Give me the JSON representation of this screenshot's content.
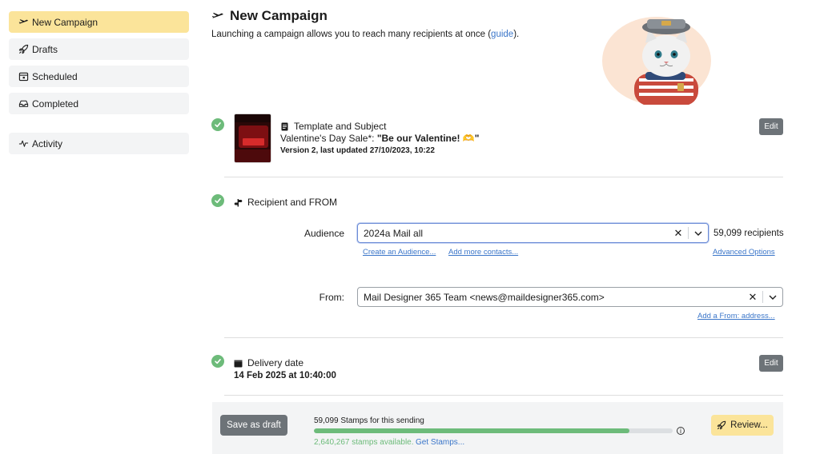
{
  "sidebar": {
    "items": [
      {
        "label": "New Campaign",
        "icon": "plane-icon",
        "active": true
      },
      {
        "label": "Drafts",
        "icon": "rocket-icon"
      },
      {
        "label": "Scheduled",
        "icon": "calendar-icon"
      },
      {
        "label": "Completed",
        "icon": "inbox-icon"
      },
      {
        "label": "Activity",
        "icon": "activity-icon"
      }
    ]
  },
  "header": {
    "title": "New Campaign",
    "subtitle_text": "Launching a campaign allows you to reach many recipients at once (",
    "subtitle_link": "guide",
    "subtitle_end": ")."
  },
  "template_section": {
    "title": "Template and Subject",
    "subject_prefix": "Valentine's Day Sale*: ",
    "subject_bold": "\"Be our Valentine! 🫶\"",
    "version": "Version 2, last updated 27/10/2023, 10:22",
    "edit_label": "Edit"
  },
  "recipient_section": {
    "title": "Recipient and FROM",
    "audience_label": "Audience",
    "audience_value": "2024a Mail all",
    "recipients_count": "59,099 recipients",
    "create_audience_link": "Create an Audience...",
    "add_contacts_link": "Add more contacts...",
    "advanced_options_link": "Advanced Options",
    "from_label": "From:",
    "from_value": "Mail Designer 365 Team <news@maildesigner365.com>",
    "add_from_link": "Add a From: address..."
  },
  "delivery_section": {
    "title": "Delivery date",
    "value": "14 Feb 2025 at 10:40:00",
    "edit_label": "Edit"
  },
  "bottom_bar": {
    "save_draft_label": "Save as draft",
    "stamps_label": "59,099 Stamps for this sending",
    "stamps_available": "2,640,267 stamps available.",
    "get_stamps_link": "Get Stamps...",
    "progress_percent": 88,
    "review_label": "Review..."
  },
  "colors": {
    "accent_yellow": "#fbe49a",
    "success_green": "#6dbb7a",
    "link_blue": "#3b76c9",
    "button_gray": "#6d7378"
  }
}
